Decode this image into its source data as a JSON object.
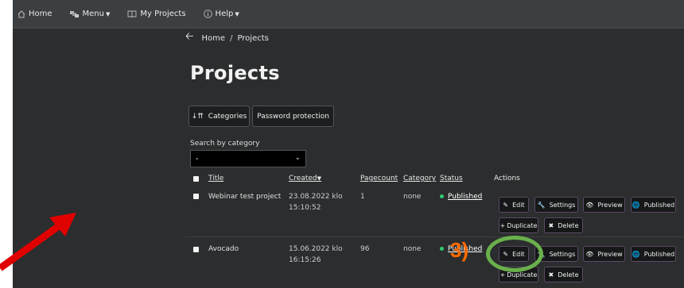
{
  "nav": {
    "home": "Home",
    "menu": "Menu",
    "my_projects": "My Projects",
    "help": "Help"
  },
  "breadcrumb": {
    "home": "Home",
    "sep": "/",
    "current": "Projects"
  },
  "page_title": "Projects",
  "filters": {
    "categories": "Categories",
    "password": "Password protection"
  },
  "search": {
    "label": "Search by category",
    "selected": "-"
  },
  "table": {
    "headers": {
      "title": "Title",
      "created": "Created",
      "pagecount": "Pagecount",
      "category": "Category",
      "status": "Status",
      "actions": "Actions"
    },
    "rows": [
      {
        "title": "Webinar test project",
        "created_date": "23.08.2022 klo",
        "created_time": "15:10:52",
        "pagecount": "1",
        "category": "none",
        "status": "Published"
      },
      {
        "title": "Avocado",
        "created_date": "15.06.2022 klo",
        "created_time": "16:15:26",
        "pagecount": "96",
        "category": "none",
        "status": "Published"
      }
    ],
    "actions": {
      "edit": "Edit",
      "settings": "Settings",
      "preview": "Preview",
      "published": "Published",
      "duplicate": "Duplicate",
      "delete": "Delete"
    }
  },
  "annotation": {
    "step": "3)",
    "color": "#ff6a00",
    "circle_color": "#6ab04c",
    "arrow_color": "#e00000"
  },
  "colors": {
    "background": "#2b2d2e",
    "navbar": "#3c3f41",
    "status_dot": "#2ecc71"
  }
}
